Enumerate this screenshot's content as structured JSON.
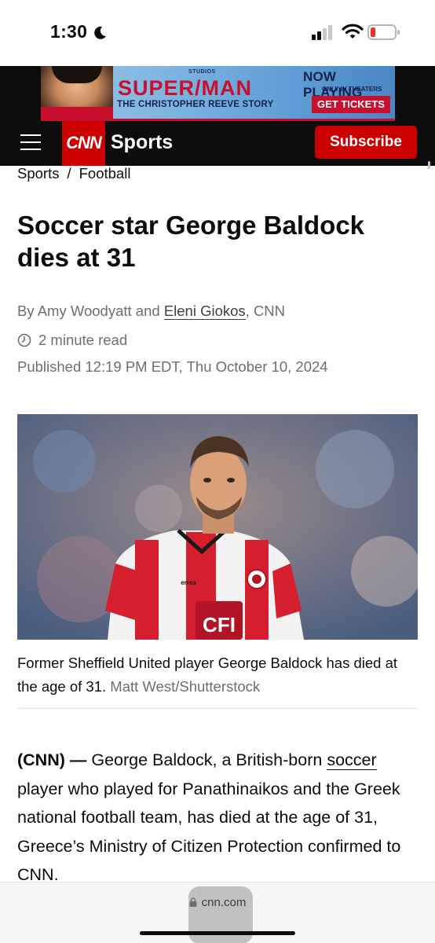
{
  "status_bar": {
    "time": "1:30",
    "icons": [
      "moon-icon",
      "signal-icon",
      "wifi-icon",
      "battery-icon"
    ],
    "battery_level": 0.15
  },
  "ad": {
    "studio": "STUDIOS",
    "title": "SUPER/MAN",
    "subtitle": "THE CHRISTOPHER REEVE STORY",
    "now_playing": "NOW PLAYING",
    "only_in_theaters": "ONLY IN THEATERS",
    "cta": "GET TICKETS"
  },
  "nav": {
    "logo": "CNN",
    "section": "Sports",
    "subscribe": "Subscribe",
    "menu_icon": "hamburger-menu-icon"
  },
  "breadcrumb": {
    "items": [
      "Sports",
      "Football"
    ],
    "separator": "/"
  },
  "article": {
    "headline": "Soccer star George Baldock dies at 31",
    "byline_prefix": "By Amy Woodyatt and ",
    "byline_link": "Eleni Giokos",
    "byline_suffix": ", CNN",
    "read_time": "2 minute read",
    "published": "Published 12:19 PM EDT, Thu October 10, 2024",
    "image_caption": "Former Sheffield United player George Baldock has died at the age of 31.",
    "image_credit": "Matt West/Shutterstock",
    "jersey_text": "CFI",
    "jersey_brand": "errea",
    "body_dateline": "(CNN) —",
    "body_text_1": " George Baldock, a British-born ",
    "body_link": "soccer",
    "body_text_2": " player who played for Panathinaikos and the Greek national football team, has died at the age of 31, Greece’s Ministry of Citizen Protection confirmed to CNN."
  },
  "browser": {
    "url": "cnn.com"
  },
  "colors": {
    "cnn_red": "#cc0000",
    "nav_black": "#0c0c0c",
    "muted_text": "#6e6e6e"
  }
}
